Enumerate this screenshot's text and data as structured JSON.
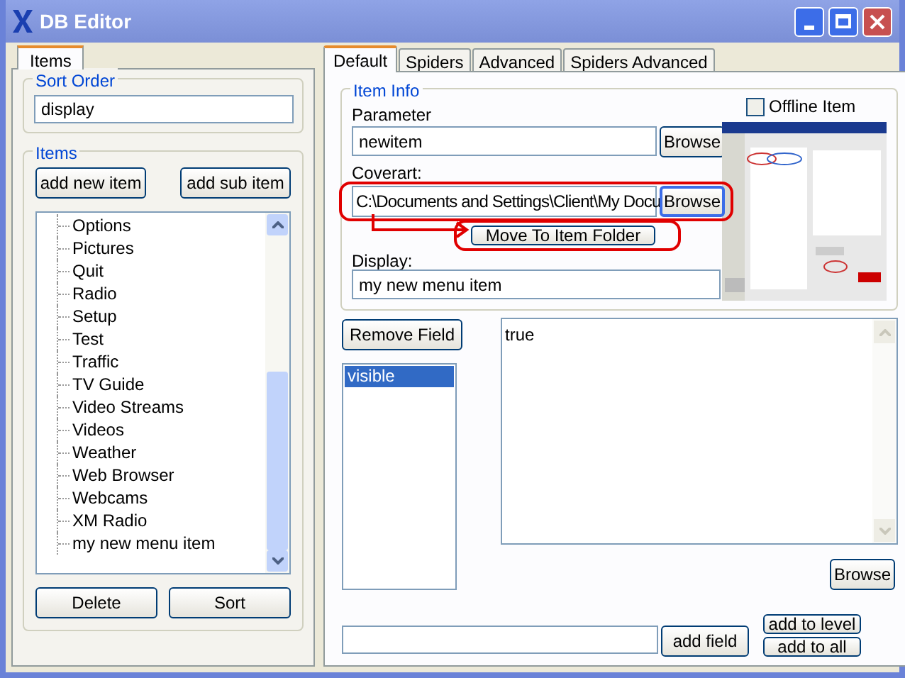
{
  "window": {
    "title": "DB Editor"
  },
  "left_tabs": [
    {
      "label": "Items",
      "selected": true
    }
  ],
  "sort_order": {
    "label": "Sort Order",
    "value": "display"
  },
  "items_group": {
    "label": "Items",
    "buttons": [
      "add new item",
      "add sub item"
    ],
    "tree": [
      {
        "label": "Options",
        "selected": false
      },
      {
        "label": "Pictures",
        "selected": false
      },
      {
        "label": "Quit",
        "selected": false
      },
      {
        "label": "Radio",
        "selected": false
      },
      {
        "label": "Setup",
        "selected": false
      },
      {
        "label": "Test",
        "selected": false
      },
      {
        "label": "Traffic",
        "selected": false
      },
      {
        "label": "TV Guide",
        "selected": false
      },
      {
        "label": "Video Streams",
        "selected": false
      },
      {
        "label": "Videos",
        "selected": false
      },
      {
        "label": "Weather",
        "selected": false
      },
      {
        "label": "Web Browser",
        "selected": false
      },
      {
        "label": "Webcams",
        "selected": false
      },
      {
        "label": "XM Radio",
        "selected": false
      },
      {
        "label": "my new menu item",
        "selected": false
      }
    ],
    "bottom_buttons": [
      "Delete",
      "Sort"
    ]
  },
  "tabs": [
    {
      "label": "Default",
      "selected": true
    },
    {
      "label": "Spiders",
      "selected": false
    },
    {
      "label": "Advanced",
      "selected": false
    },
    {
      "label": "Spiders Advanced",
      "selected": false
    }
  ],
  "item_info": {
    "label": "Item Info",
    "offline": {
      "label": "Offline Item",
      "checked": false
    },
    "parameter": {
      "label": "Parameter",
      "value": "newitem",
      "button": "Browse"
    },
    "coverart": {
      "label": "Coverart:",
      "value": "C:\\Documents and Settings\\Client\\My Docu",
      "button": "Browse",
      "highlighted": true
    },
    "move_button": "Move To Item Folder",
    "display": {
      "label": "Display:",
      "value": "my new menu item"
    }
  },
  "fields": {
    "remove_button": "Remove Field",
    "list": [
      {
        "label": "visible",
        "selected": true
      }
    ],
    "value": "true",
    "browse_button": "Browse",
    "add_field_button": "add field",
    "add_to_level_button": "add to level",
    "add_to_all_button": "add to all"
  }
}
